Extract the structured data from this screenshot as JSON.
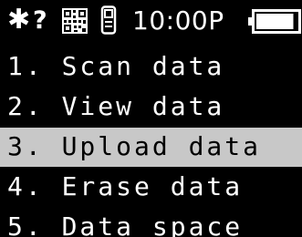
{
  "status_bar": {
    "bluetooth_icon": "bluetooth-icon",
    "bluetooth_glyph": "✱",
    "help_icon": "question-mark-icon",
    "help_glyph": "?",
    "qr_icon": "qr-code-icon",
    "scanner_icon": "scanner-device-icon",
    "time": "10:00P",
    "battery_icon": "battery-icon",
    "battery_level": 0.92
  },
  "menu": {
    "selected_index": 2,
    "items": [
      {
        "label": "1. Scan data"
      },
      {
        "label": "2. View data"
      },
      {
        "label": "3. Upload data"
      },
      {
        "label": "4. Erase data"
      },
      {
        "label": "5. Data space"
      }
    ]
  },
  "colors": {
    "background": "#000000",
    "text": "#ffffff",
    "selection": "#c8c8c8",
    "selected_text": "#000000"
  }
}
